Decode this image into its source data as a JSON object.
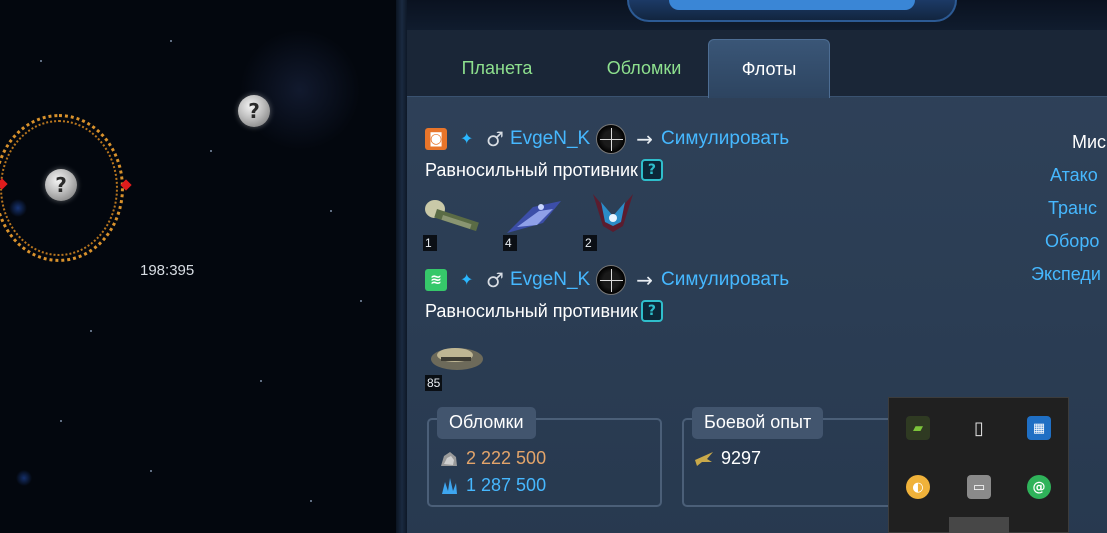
{
  "map": {
    "coordinates": "198:395",
    "unknown_planet_mark": "?"
  },
  "tabs": [
    {
      "label": "Планета",
      "active": false
    },
    {
      "label": "Обломки",
      "active": false
    },
    {
      "label": "Флоты",
      "active": true
    }
  ],
  "fleets": [
    {
      "player": "EvgeN_K",
      "action": "Симулировать",
      "enemy_label": "Равносильный противник",
      "help": "?",
      "alliance_color": "#e8752a",
      "ships": [
        {
          "name": "ship-transport-icon",
          "count": "1"
        },
        {
          "name": "ship-cruiser-icon",
          "count": "4"
        },
        {
          "name": "ship-alien-icon",
          "count": "2"
        }
      ]
    },
    {
      "player": "EvgeN_K",
      "action": "Симулировать",
      "enemy_label": "Равносильный противник",
      "help": "?",
      "alliance_color": "#36c86a",
      "ships": [
        {
          "name": "ship-recycler-icon",
          "count": "85"
        }
      ]
    }
  ],
  "debris": {
    "title": "Обломки",
    "metal": "2 222 500",
    "crystal": "1 287 500",
    "metal_color": "#e3a46a",
    "crystal_color": "#46b8ff"
  },
  "experience": {
    "title": "Боевой опыт",
    "value": "9297"
  },
  "missions": {
    "header": "Мис",
    "items": [
      "Атако",
      "Транс",
      "Оборо",
      "Экспеди"
    ]
  },
  "tray": {
    "icons": [
      "nvidia-icon",
      "usb-drive-icon",
      "intel-graphics-icon",
      "sticky-note-icon",
      "window-icon",
      "mail-at-icon"
    ]
  }
}
